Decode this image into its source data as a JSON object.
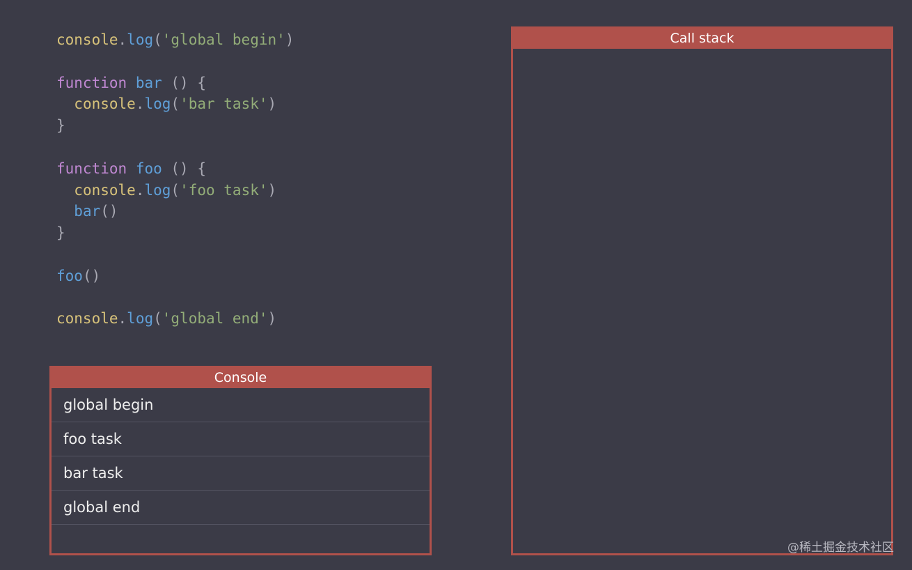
{
  "code": {
    "lines": [
      [
        {
          "t": "obj",
          "v": "console"
        },
        {
          "t": "punc",
          "v": "."
        },
        {
          "t": "fn",
          "v": "log"
        },
        {
          "t": "punc",
          "v": "("
        },
        {
          "t": "str",
          "v": "'global begin'"
        },
        {
          "t": "punc",
          "v": ")"
        }
      ],
      [],
      [
        {
          "t": "kw",
          "v": "function"
        },
        {
          "t": "punc",
          "v": " "
        },
        {
          "t": "fn",
          "v": "bar"
        },
        {
          "t": "punc",
          "v": " () {"
        }
      ],
      [
        {
          "t": "punc",
          "v": "  "
        },
        {
          "t": "obj",
          "v": "console"
        },
        {
          "t": "punc",
          "v": "."
        },
        {
          "t": "fn",
          "v": "log"
        },
        {
          "t": "punc",
          "v": "("
        },
        {
          "t": "str",
          "v": "'bar task'"
        },
        {
          "t": "punc",
          "v": ")"
        }
      ],
      [
        {
          "t": "punc",
          "v": "}"
        }
      ],
      [],
      [
        {
          "t": "kw",
          "v": "function"
        },
        {
          "t": "punc",
          "v": " "
        },
        {
          "t": "fn",
          "v": "foo"
        },
        {
          "t": "punc",
          "v": " () {"
        }
      ],
      [
        {
          "t": "punc",
          "v": "  "
        },
        {
          "t": "obj",
          "v": "console"
        },
        {
          "t": "punc",
          "v": "."
        },
        {
          "t": "fn",
          "v": "log"
        },
        {
          "t": "punc",
          "v": "("
        },
        {
          "t": "str",
          "v": "'foo task'"
        },
        {
          "t": "punc",
          "v": ")"
        }
      ],
      [
        {
          "t": "punc",
          "v": "  "
        },
        {
          "t": "fn",
          "v": "bar"
        },
        {
          "t": "punc",
          "v": "()"
        }
      ],
      [
        {
          "t": "punc",
          "v": "}"
        }
      ],
      [],
      [
        {
          "t": "fn",
          "v": "foo"
        },
        {
          "t": "punc",
          "v": "()"
        }
      ],
      [],
      [
        {
          "t": "obj",
          "v": "console"
        },
        {
          "t": "punc",
          "v": "."
        },
        {
          "t": "fn",
          "v": "log"
        },
        {
          "t": "punc",
          "v": "("
        },
        {
          "t": "str",
          "v": "'global end'"
        },
        {
          "t": "punc",
          "v": ")"
        }
      ]
    ]
  },
  "console": {
    "title": "Console",
    "lines": [
      "global begin",
      "foo task",
      "bar task",
      "global end"
    ]
  },
  "call_stack": {
    "title": "Call stack",
    "frames": []
  },
  "watermark": "@稀土掘金技术社区",
  "colors": {
    "background": "#3b3b47",
    "panel_accent": "#b0514b",
    "keyword": "#c088d2",
    "object": "#d7c27a",
    "function": "#5f9fd8",
    "string": "#93ad78",
    "punctuation": "#a9a9b3"
  }
}
